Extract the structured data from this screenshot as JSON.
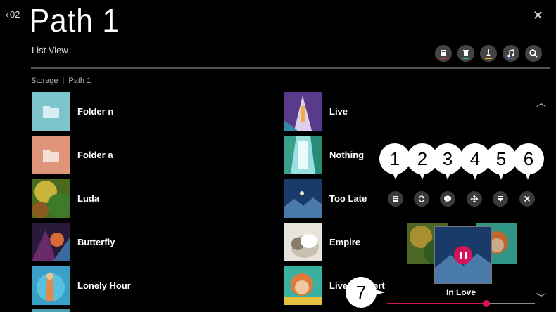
{
  "header": {
    "back_label": "02",
    "title": "Path 1",
    "view_mode": "List View"
  },
  "breadcrumb": [
    "Storage",
    "Path 1"
  ],
  "list_left": [
    {
      "label": "Folder n",
      "kind": "folder",
      "color": "#7ec4cc"
    },
    {
      "label": "Folder a",
      "kind": "folder",
      "color": "#e0947a"
    },
    {
      "label": "Luda",
      "kind": "image"
    },
    {
      "label": "Butterfly",
      "kind": "image"
    },
    {
      "label": "Lonely Hour",
      "kind": "image"
    }
  ],
  "list_right": [
    {
      "label": "Live",
      "kind": "image"
    },
    {
      "label": "Nothing",
      "kind": "image"
    },
    {
      "label": "Too Late",
      "kind": "image"
    },
    {
      "label": "Empire",
      "kind": "image"
    },
    {
      "label": "Live Concert",
      "kind": "image"
    }
  ],
  "toolbar_icons": [
    "playlist-icon",
    "delete-icon",
    "sort-icon",
    "music-icon",
    "search-icon"
  ],
  "toolbar_colors": [
    "#d33",
    "#2c6",
    "#eb2",
    "#36c",
    ""
  ],
  "player": {
    "song": "In Love",
    "progress": 0.67,
    "controls": [
      "playlist-icon",
      "repeat-icon",
      "lyrics-icon",
      "move-icon",
      "minimize-icon",
      "close-icon"
    ]
  },
  "callouts": [
    "1",
    "2",
    "3",
    "4",
    "5",
    "6",
    "7"
  ],
  "accent": "#d6145a"
}
